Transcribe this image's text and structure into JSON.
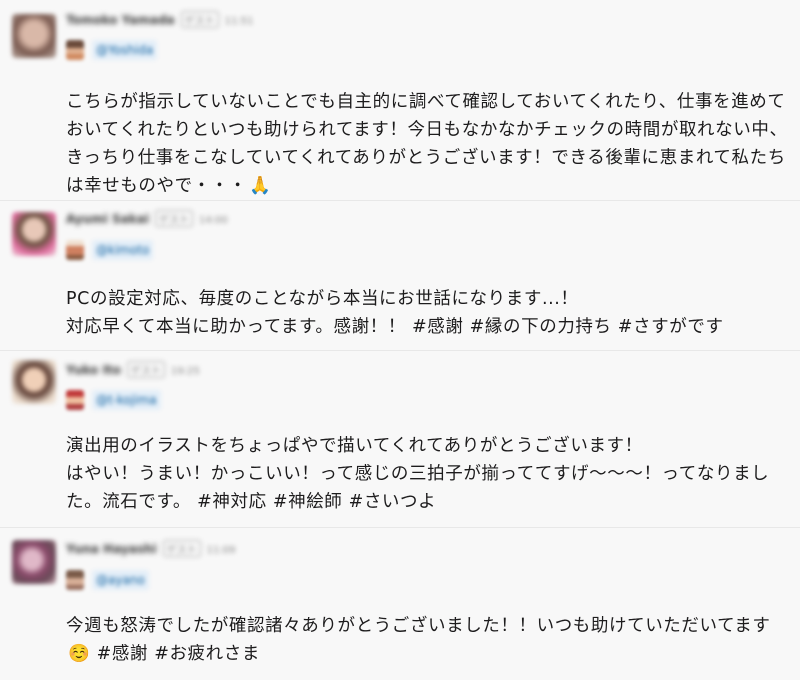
{
  "messages": [
    {
      "author": "Tomoko Yamada",
      "tag": "ゲスト",
      "time": "11:51",
      "mention": "@Yoshida",
      "lines": [
        "こちらが指示していないことでも自主的に調べて確認しておいてくれたり、仕事を進めて",
        "おいてくれたりといつも助けられてます！今日もなかなかチェックの時間が取れない中、",
        "きっちり仕事をこなしていてくれてありがとうございます！できる後輩に恵まれて私たち",
        "は幸せものやで・・・"
      ],
      "emoji": "🙏",
      "avatar_color": "#b08a7a",
      "mention_avatar_color": "#c89070"
    },
    {
      "author": "Ayumi Sakai",
      "tag": "ゲスト",
      "time": "14:00",
      "mention": "@kimoto",
      "lines": [
        "PCの設定対応、毎度のことながら本当にお世話になります...！",
        "対応早くて本当に助かってます。感謝！！ #感謝 #縁の下の力持ち #さすがです"
      ],
      "emoji": "",
      "avatar_color": "#d8a0b8",
      "mention_avatar_color": "#d09070"
    },
    {
      "author": "Yuko Ito",
      "tag": "ゲスト",
      "time": "19:25",
      "mention": "@t-kojima",
      "lines": [
        "演出用のイラストをちょっぱやで描いてくれてありがとうございます！",
        "はやい！うまい！かっこいい！って感じの三拍子が揃っててすげ〜〜〜！ってなりまし",
        "た。流石です。 #神対応 #神絵師 #さいつよ"
      ],
      "emoji": "",
      "avatar_color": "#c8a890",
      "mention_avatar_color": "#b04040"
    },
    {
      "author": "Yuna Hayashi",
      "tag": "ゲスト",
      "time": "11:09",
      "mention": "@ayano",
      "lines": [
        "今週も怒涛でしたが確認諸々ありがとうございました！！いつも助けていただいてます",
        "#感謝 #お疲れさま"
      ],
      "emoji_prefix_line2": "☺️",
      "emoji": "",
      "avatar_color": "#9a7890",
      "mention_avatar_color": "#a08068"
    }
  ]
}
